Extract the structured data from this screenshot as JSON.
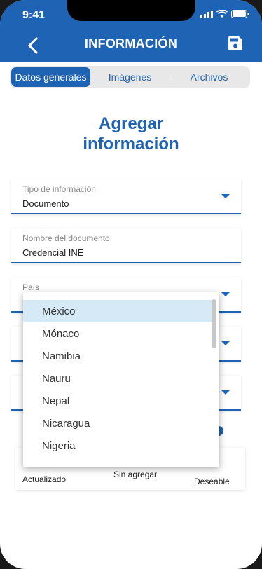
{
  "status_bar": {
    "time": "9:41"
  },
  "header": {
    "title": "INFORMACIÓN",
    "back_icon": "chevron-left-icon",
    "save_icon": "save-icon"
  },
  "tabs": [
    {
      "label": "Datos generales",
      "active": true
    },
    {
      "label": "Imágenes",
      "active": false
    },
    {
      "label": "Archivos",
      "active": false
    }
  ],
  "heading": {
    "line1": "Agregar",
    "line2": "información"
  },
  "fields": {
    "tipo": {
      "label": "Tipo de información",
      "value": "Documento"
    },
    "nombre": {
      "label": "Nombre del documento",
      "value": "Credencial INE"
    },
    "pais": {
      "label": "País",
      "value": ""
    }
  },
  "card": {
    "updated": "Actualizado",
    "not_added": "Sin agregar",
    "desirable": "Deseable"
  },
  "dropdown": {
    "selected": "México",
    "options": [
      "México",
      "Mónaco",
      "Namibia",
      "Nauru",
      "Nepal",
      "Nicaragua",
      "Nigeria"
    ]
  },
  "colors": {
    "primary": "#1f63b5",
    "selected_option": "#d6e9f7"
  }
}
